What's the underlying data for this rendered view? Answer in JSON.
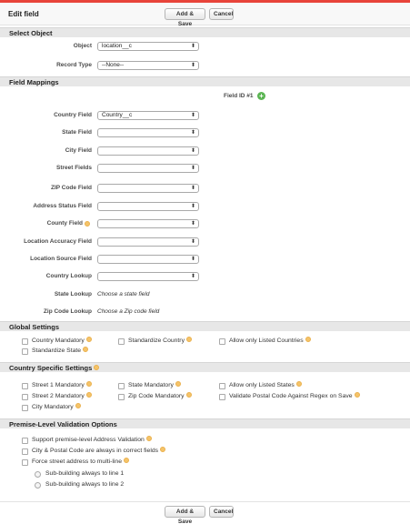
{
  "header": {
    "title": "Edit field",
    "add_save_label": "Add & Save",
    "cancel_label": "Cancel"
  },
  "select_object": {
    "title": "Select Object",
    "object_label": "Object",
    "object_value": "location__c",
    "record_type_label": "Record Type",
    "record_type_value": "--None--"
  },
  "field_mappings": {
    "title": "Field Mappings",
    "field_id_label": "Field ID #1",
    "fields": [
      {
        "label": "Country Field",
        "value": "Country__c"
      },
      {
        "label": "State Field",
        "value": ""
      },
      {
        "label": "City Field",
        "value": ""
      },
      {
        "label": "Street Fields",
        "value": ""
      },
      {
        "label": "ZIP Code Field",
        "value": ""
      },
      {
        "label": "Address Status Field",
        "value": ""
      },
      {
        "label": "County Field",
        "value": ""
      },
      {
        "label": "Location Accuracy Field",
        "value": ""
      },
      {
        "label": "Location Source Field",
        "value": ""
      },
      {
        "label": "Country Lookup",
        "value": ""
      }
    ],
    "state_lookup_label": "State Lookup",
    "state_lookup_value": "Choose a state field",
    "zip_lookup_label": "Zip Code Lookup",
    "zip_lookup_value": "Choose a Zip code field"
  },
  "global_settings": {
    "title": "Global Settings",
    "options": [
      "Country Mandatory",
      "Standardize Country",
      "Allow only Listed Countries",
      "Standardize State"
    ]
  },
  "country_specific": {
    "title": "Country Specific Settings",
    "options": [
      "Street 1 Mandatory",
      "State Mandatory",
      "Allow only Listed States",
      "Street 2 Mandatory",
      "Zip Code Mandatory",
      "Validate Postal Code Against Regex on Save",
      "City Mandatory"
    ]
  },
  "premise": {
    "title": "Premise-Level Validation Options",
    "options": [
      "Support premise-level Address Validation",
      "City & Postal Code are always in correct fields",
      "Force street address to multi-line"
    ],
    "radios": [
      "Sub-building always to line 1",
      "Sub-building always to line 2"
    ]
  },
  "footer": {
    "add_save_label": "Add & Save",
    "cancel_label": "Cancel"
  },
  "colors": {
    "accent_bar": "#e8443a",
    "section_bg": "#e7e7e7",
    "help_icon": "#f5c46a",
    "add_icon": "#5bb553"
  }
}
